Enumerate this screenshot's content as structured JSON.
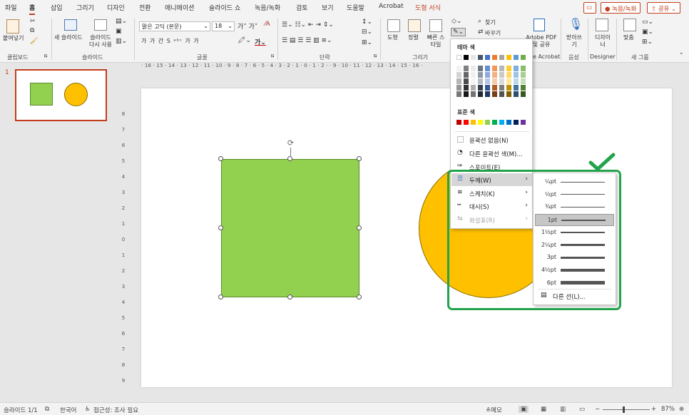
{
  "tabs": [
    "파일",
    "홈",
    "삽입",
    "그리기",
    "디자인",
    "전환",
    "애니메이션",
    "슬라이드 쇼",
    "녹음/녹화",
    "검토",
    "보기",
    "도움말",
    "Acrobat",
    "도형 서식"
  ],
  "top_right": {
    "record": "● 녹음/녹화",
    "share": "⇧ 공유 ⌄"
  },
  "ribbon": {
    "groups": [
      "클립보드",
      "슬라이드",
      "글꼴",
      "단락",
      "그리기",
      "Acrobat",
      "음성",
      "Designer",
      "새 그룹"
    ],
    "paste": "붙여넣기",
    "new_slide": "새 슬라이드",
    "reuse_slide": "슬라이드 다시 사용",
    "font_name": "맑은 고딕 (본문)",
    "font_size": "18",
    "format_row": "가  가  간  S  ᵃᵇᶜ  가  가",
    "find": "찾기",
    "replace": "바꾸기",
    "shapes": "도형",
    "arrange": "정렬",
    "quick_styles": "빠른 스타일",
    "acrobat_btn": "Adobe PDF 및 공유",
    "acrobat_prefix": "e Acrobat",
    "dictate": "받아쓰기",
    "designer": "디자이너",
    "fit": "맞춤"
  },
  "ruler_h": "· 16 · 15 · 14 · 13 · 12 · 11 · 10 · 9 · 8 · 7 · 6 · 5 · 4 · 3 · 2 · 1 · 0 · 1 · 2 ·                            · 9 · 10 · 11 · 12 · 13 · 14 · 15 · 16 ·",
  "ruler_v": [
    "8",
    "7",
    "6",
    "5",
    "4",
    "3",
    "2",
    "1",
    "0",
    "1",
    "2",
    "3",
    "4",
    "5",
    "6",
    "7",
    "8",
    "9"
  ],
  "slide_number": "1",
  "status": {
    "slide": "슬라이드 1/1",
    "language": "한국어",
    "accessibility": "접근성: 조사 필요",
    "notes": "≙메모",
    "zoom": "87%"
  },
  "outline_menu": {
    "theme_colors": "테마 색",
    "standard_colors": "표준 색",
    "no_outline": "윤곽선 없음(N)",
    "more_colors": "다른 윤곽선 색(M)...",
    "eyedropper": "스포이트(E)",
    "weight": "두께(W)",
    "sketch": "스케치(K)",
    "dash": "대시(S)",
    "arrows": "화살표(R)"
  },
  "theme_palette": [
    "#ffffff",
    "#000000",
    "#e7e6e6",
    "#44546a",
    "#4472c4",
    "#ed7d31",
    "#a5a5a5",
    "#ffc000",
    "#5b9bd5",
    "#70ad47"
  ],
  "standard_palette": [
    "#c00000",
    "#ff0000",
    "#ffc000",
    "#ffff00",
    "#92d050",
    "#00b050",
    "#00b0f0",
    "#0070c0",
    "#002060",
    "#7030a0"
  ],
  "weight_menu": {
    "options": [
      "¼pt",
      "½pt",
      "¾pt",
      "1pt",
      "1½pt",
      "2¼pt",
      "3pt",
      "4½pt",
      "6pt"
    ],
    "selected": "1pt",
    "more_lines": "다른 선(L)..."
  },
  "colors": {
    "accent": "#c43e1c",
    "shape_rect": "#92d050",
    "shape_circle": "#ffc000",
    "highlight": "#22a34c"
  }
}
